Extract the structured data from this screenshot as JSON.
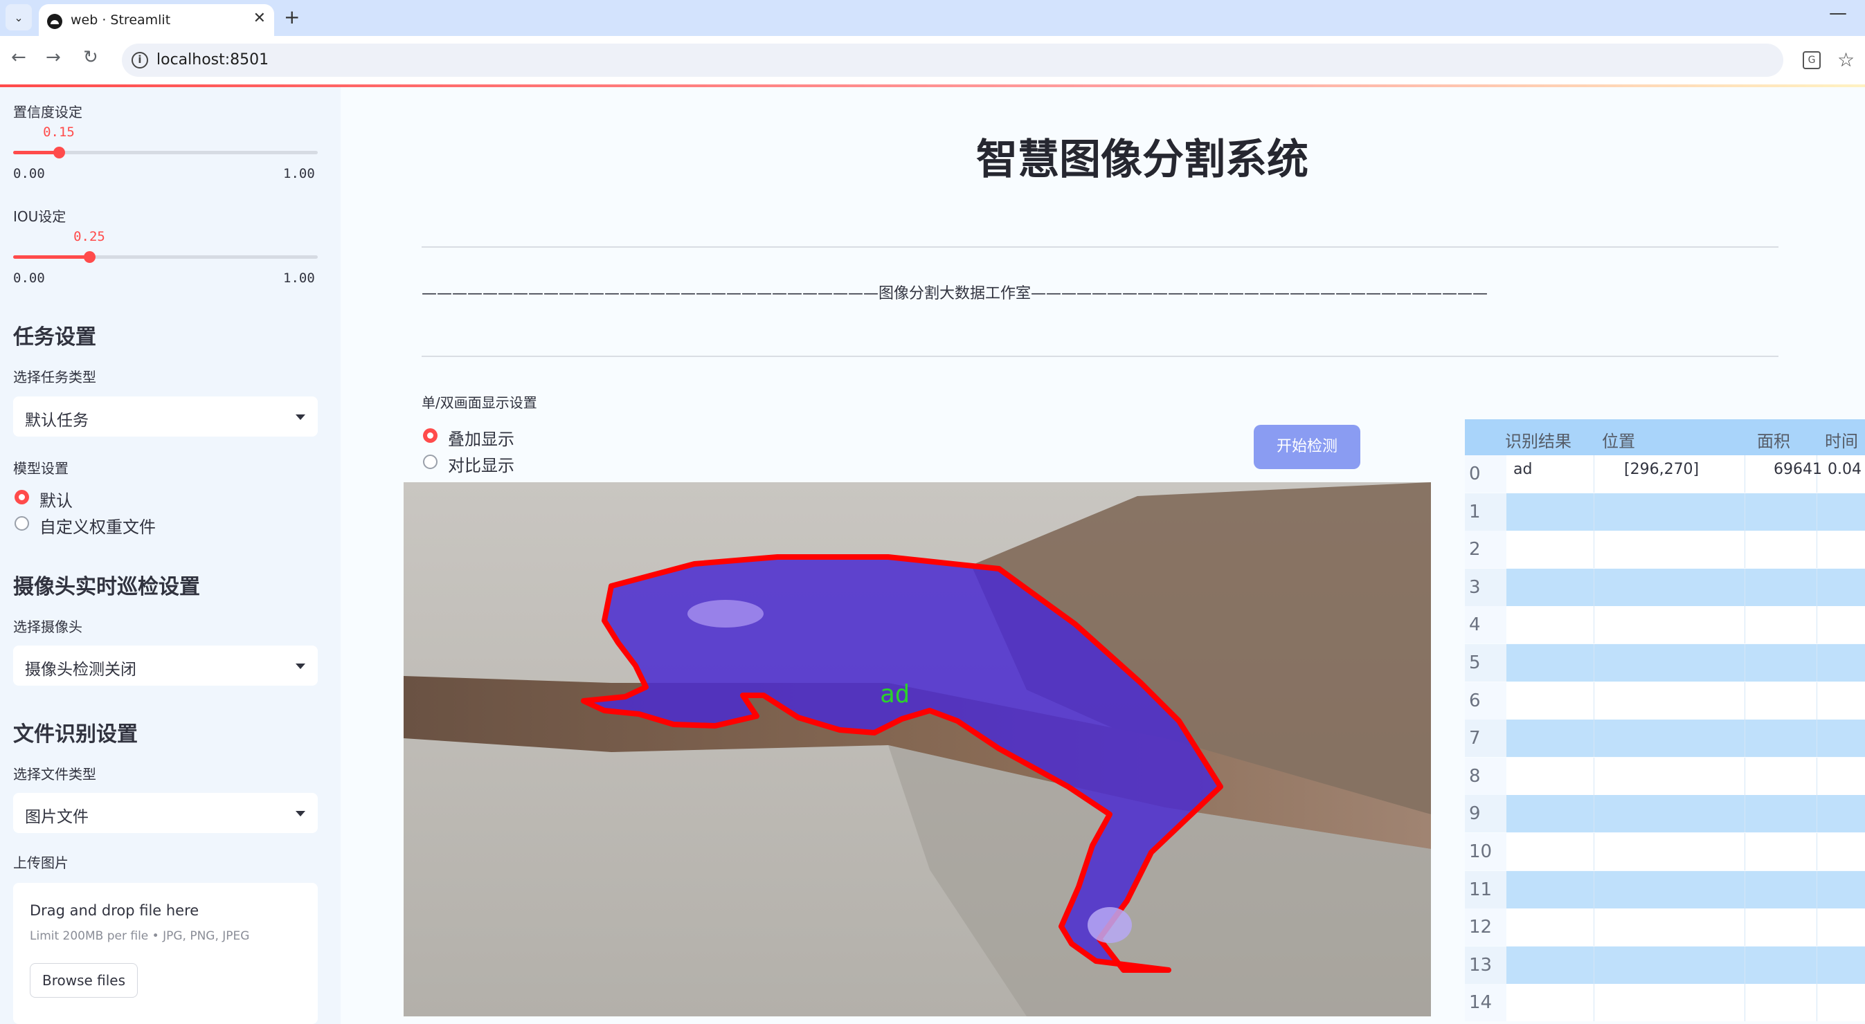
{
  "browser": {
    "tab_title": "web · Streamlit",
    "url": "localhost:8501",
    "icons": [
      "chevron-down-icon",
      "close-icon",
      "plus-icon",
      "minimize-icon",
      "back-icon",
      "forward-icon",
      "reload-icon",
      "info-icon",
      "translate-icon",
      "star-icon"
    ]
  },
  "sidebar": {
    "confidence": {
      "label": "置信度设定",
      "value": "0.15",
      "fraction": 0.15,
      "min": "0.00",
      "max": "1.00"
    },
    "iou": {
      "label": "IOU设定",
      "value": "0.25",
      "fraction": 0.25,
      "min": "0.00",
      "max": "1.00"
    },
    "task_header": "任务设置",
    "task_type_label": "选择任务类型",
    "task_type_value": "默认任务",
    "model_label": "模型设置",
    "model_options": [
      "默认",
      "自定义权重文件"
    ],
    "model_selected": 0,
    "camera_header": "摄像头实时巡检设置",
    "camera_label": "选择摄像头",
    "camera_value": "摄像头检测关闭",
    "file_header": "文件识别设置",
    "file_type_label": "选择文件类型",
    "file_type_value": "图片文件",
    "upload_label": "上传图片",
    "uploader_title": "Drag and drop file here",
    "uploader_hint": "Limit 200MB per file • JPG, PNG, JPEG",
    "browse_label": "Browse files"
  },
  "main": {
    "title": "智慧图像分割系统",
    "banner": "——————————————————————————————图像分割大数据工作室——————————————————————————————",
    "display_label": "单/双画面显示设置",
    "display_options": [
      "叠加显示",
      "对比显示"
    ],
    "display_selected": 0,
    "start_button": "开始检测",
    "detection_label": "ad",
    "accent_color": "#ff4b4b",
    "mask_color": "#4b2bd0",
    "outline_color": "#ff0000"
  },
  "table": {
    "columns": [
      "识别结果",
      "位置",
      "面积",
      "时间"
    ],
    "rows": [
      {
        "index": "0",
        "result": "ad",
        "position": "[296,270]",
        "area": "69641",
        "time": "0.04"
      },
      {
        "index": "1"
      },
      {
        "index": "2"
      },
      {
        "index": "3"
      },
      {
        "index": "4"
      },
      {
        "index": "5"
      },
      {
        "index": "6"
      },
      {
        "index": "7"
      },
      {
        "index": "8"
      },
      {
        "index": "9"
      },
      {
        "index": "10"
      },
      {
        "index": "11"
      },
      {
        "index": "12"
      },
      {
        "index": "13"
      },
      {
        "index": "14"
      }
    ]
  }
}
